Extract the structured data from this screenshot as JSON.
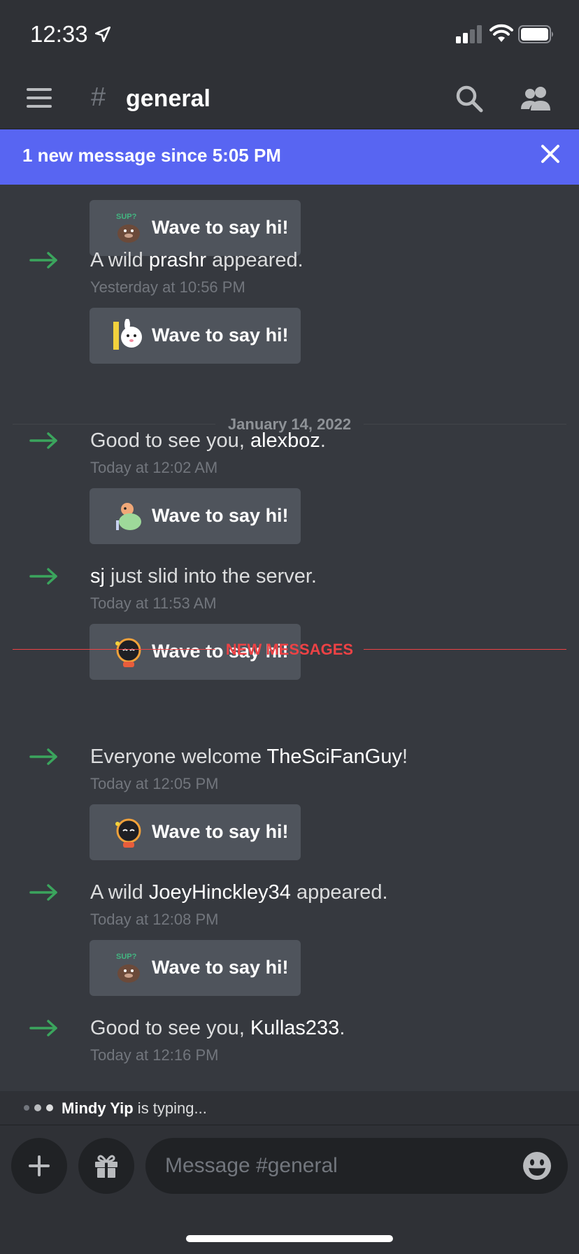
{
  "status_bar": {
    "time": "12:33"
  },
  "header": {
    "hash_symbol": "#",
    "channel_name": "general"
  },
  "new_message_bar": {
    "text": "1 new message since 5:05 PM"
  },
  "wave_label": "Wave to say hi!",
  "date_divider": "January 14, 2022",
  "new_messages_divider": "NEW MESSAGES",
  "messages": [
    {
      "pre": "A wild ",
      "user": "prashr",
      "post": " appeared.",
      "time": "Yesterday at 10:56 PM"
    },
    {
      "pre": "Good to see you, ",
      "user": "alexboz",
      "post": ".",
      "time": "Today at 12:02 AM"
    },
    {
      "pre": "",
      "user": "sj",
      "post": " just slid into the server.",
      "time": "Today at 11:53 AM"
    },
    {
      "pre": "Everyone welcome ",
      "user": "TheSciFanGuy",
      "post": "!",
      "time": "Today at 12:05 PM"
    },
    {
      "pre": "A wild ",
      "user": "JoeyHinckley34",
      "post": " appeared.",
      "time": "Today at 12:08 PM"
    },
    {
      "pre": "Good to see you, ",
      "user": "Kullas233",
      "post": ".",
      "time": "Today at 12:16 PM"
    }
  ],
  "typing": {
    "user": "Mindy Yip",
    "text": " is typing..."
  },
  "composer": {
    "placeholder": "Message #general"
  },
  "colors": {
    "background": "#36393f",
    "header": "#2f3136",
    "blurple": "#5865f2",
    "join_arrow": "#3ba55d",
    "new_divider": "#ed4245",
    "wave_button": "#4f545c"
  }
}
